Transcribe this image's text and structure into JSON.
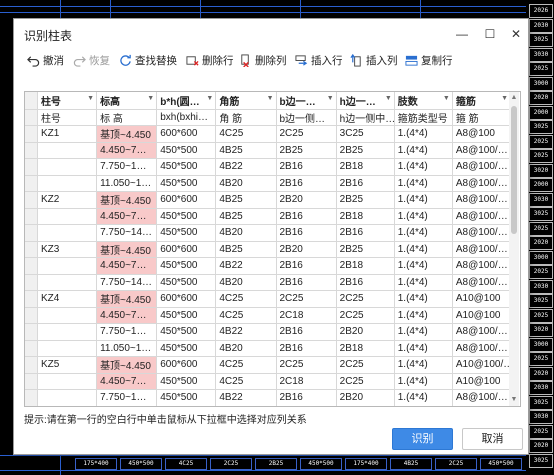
{
  "dialog": {
    "title": "识别柱表",
    "minimize": "—",
    "maximize": "☐",
    "close": "✕"
  },
  "toolbar": {
    "undo": "撤消",
    "redo": "恢复",
    "find_replace": "查找替换",
    "delete_row": "删除行",
    "delete_col": "删除列",
    "insert_row": "插入行",
    "insert_col": "插入列",
    "copy_row": "复制行"
  },
  "table": {
    "headers": [
      "柱号",
      "标高",
      "b*h(圆…",
      "角筋",
      "b边一…",
      "h边一…",
      "肢数",
      "箍筋"
    ],
    "subheaders": [
      "柱号",
      "标 高",
      "bxh(bxhi…",
      "角 筋",
      "b边一侧…",
      "h边一侧中…",
      "箍筋类型号",
      "箍 筋"
    ],
    "rows": [
      [
        "KZ1",
        "基顶~4.450",
        "600*600",
        "4C25",
        "2C25",
        "3C25",
        "1.(4*4)",
        "A8@100"
      ],
      [
        "",
        "4.450~7…",
        "450*500",
        "4B25",
        "2B25",
        "2B25",
        "1.(4*4)",
        "A8@100/…"
      ],
      [
        "",
        "7.750~1…",
        "450*500",
        "4B22",
        "2B16",
        "2B18",
        "1.(4*4)",
        "A8@100/…"
      ],
      [
        "",
        "11.050~1…",
        "450*500",
        "4B20",
        "2B16",
        "2B16",
        "1.(4*4)",
        "A8@100/…"
      ],
      [
        "KZ2",
        "基顶~4.450",
        "600*600",
        "4B25",
        "2B20",
        "2B25",
        "1.(4*4)",
        "A8@100/…"
      ],
      [
        "",
        "4.450~7…",
        "450*500",
        "4B25",
        "2B16",
        "2B18",
        "1.(4*4)",
        "A8@100/…"
      ],
      [
        "",
        "7.750~14…",
        "450*500",
        "4B20",
        "2B16",
        "2B16",
        "1.(4*4)",
        "A8@100/…"
      ],
      [
        "KZ3",
        "基顶~4.450",
        "600*600",
        "4B25",
        "2B20",
        "2B25",
        "1.(4*4)",
        "A8@100/…"
      ],
      [
        "",
        "4.450~7…",
        "450*500",
        "4B22",
        "2B16",
        "2B18",
        "1.(4*4)",
        "A8@100/…"
      ],
      [
        "",
        "7.750~14…",
        "450*500",
        "4B20",
        "2B16",
        "2B16",
        "1.(4*4)",
        "A8@100/…"
      ],
      [
        "KZ4",
        "基顶~4.450",
        "600*600",
        "4C25",
        "2C25",
        "2C25",
        "1.(4*4)",
        "A10@100"
      ],
      [
        "",
        "4.450~7…",
        "450*500",
        "4C25",
        "2C18",
        "2C25",
        "1.(4*4)",
        "A10@100"
      ],
      [
        "",
        "7.750~1…",
        "450*500",
        "4B22",
        "2B16",
        "2B20",
        "1.(4*4)",
        "A8@100/…"
      ],
      [
        "",
        "11.050~1…",
        "450*500",
        "4B20",
        "2B16",
        "2B18",
        "1.(4*4)",
        "A8@100/…"
      ],
      [
        "KZ5",
        "基顶~4.450",
        "600*600",
        "4C25",
        "2C25",
        "2C25",
        "1.(4*4)",
        "A10@100/…"
      ],
      [
        "",
        "4.450~7…",
        "450*500",
        "4C25",
        "2C18",
        "2C25",
        "1.(4*4)",
        "A10@100"
      ],
      [
        "",
        "7.750~1…",
        "450*500",
        "4B22",
        "2B16",
        "2B20",
        "1.(4*4)",
        "A8@100/…"
      ]
    ],
    "pink_rows": [
      0,
      1,
      4,
      5,
      7,
      8,
      10,
      11,
      14,
      15
    ]
  },
  "hint": "提示:请在第一行的空白行中单击鼠标从下拉框中选择对应列关系",
  "buttons": {
    "ok": "识别",
    "cancel": "取消"
  },
  "cad_right_labels": [
    "2026",
    "2030",
    "3025",
    "3030",
    "2025",
    "3000",
    "2020",
    "2000",
    "3025",
    "2025",
    "2025",
    "3020",
    "2000",
    "3030",
    "3025",
    "2025",
    "2020",
    "3000",
    "2025",
    "2030",
    "3025",
    "2025",
    "3020",
    "3000",
    "2025",
    "2020",
    "2030",
    "3025",
    "3030",
    "2025",
    "2020",
    "3025"
  ],
  "cad_bottom_labels": [
    "175*400",
    "450*500",
    "4C25",
    "2C25",
    "2B25",
    "450*500",
    "175*400",
    "4B25",
    "2C25",
    "450*500"
  ],
  "colors": {
    "accent": "#3e8ae6",
    "pink_cell": "#f8c9c9",
    "cad_blue": "#2a5fd0"
  }
}
